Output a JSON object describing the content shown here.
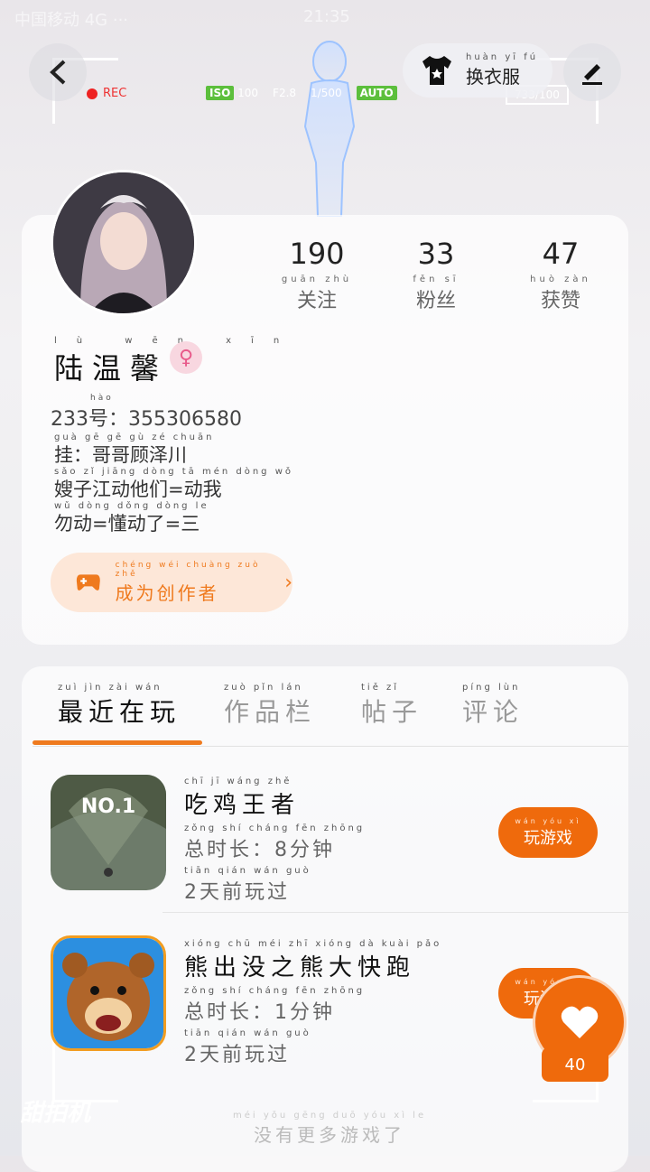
{
  "status": {
    "time": "21:35",
    "left": "中国移动 4G ···"
  },
  "camera": {
    "rec": "REC",
    "iso_tag": "ISO",
    "iso_val": "100",
    "aperture": "F2.8",
    "shutter": "1/500",
    "auto_tag": "AUTO",
    "counter": "733/100",
    "brand": "甜拍机"
  },
  "topbar": {
    "back_label": "返回",
    "outfit_pinyin": "huàn yī fú",
    "outfit_label": "换衣服"
  },
  "profile": {
    "stats": [
      {
        "num": "190",
        "pinyin": "guān zhù",
        "label": "关注"
      },
      {
        "num": "33",
        "pinyin": "fěn sī",
        "label": "粉丝"
      },
      {
        "num": "47",
        "pinyin": "huò zàn",
        "label": "获赞"
      }
    ],
    "name_pinyin": "lù wēn xīn",
    "name": "陆温馨",
    "gender_symbol": "♀",
    "id_pinyin": "hào",
    "id_line": "233号：355306580",
    "bio_lines": [
      {
        "pinyin": "guà   gē gē gù zé chuān",
        "text": "挂：哥哥顾泽川"
      },
      {
        "pinyin": "sǎo zǐ jiāng dòng tā mén dòng wǒ",
        "text": "嫂子江动他们=动我"
      },
      {
        "pinyin": "wǔ dòng  dǒng dòng le",
        "text": "勿动=懂动了=三"
      }
    ],
    "creator_pinyin": "chéng wéi chuàng zuò zhě",
    "creator_label": "成为创作者"
  },
  "tabs": [
    {
      "pinyin": "zuì jìn zài wán",
      "label": "最近在玩",
      "active": true
    },
    {
      "pinyin": "zuò pǐn lán",
      "label": "作品栏",
      "active": false
    },
    {
      "pinyin": "tiě zǐ",
      "label": "帖子",
      "active": false
    },
    {
      "pinyin": "píng lùn",
      "label": "评论",
      "active": false
    }
  ],
  "games": [
    {
      "title_pinyin": "chī jī wáng zhě",
      "title": "吃鸡王者",
      "time_pinyin": "zǒng shí cháng    fēn zhōng",
      "time": "总时长：8分钟",
      "ago_pinyin": "tiān qián wán guò",
      "ago": "2天前玩过",
      "icon_text": "NO.1",
      "play_pinyin": "wán yóu xì",
      "play": "玩游戏"
    },
    {
      "title_pinyin": "xióng chū méi zhī xióng dà kuài pǎo",
      "title": "熊出没之熊大快跑",
      "time_pinyin": "zǒng shí cháng    fēn zhōng",
      "time": "总时长：1分钟",
      "ago_pinyin": "tiān qián wán guò",
      "ago": "2天前玩过",
      "play_pinyin": "wán yóu xì",
      "play": "玩游戏"
    }
  ],
  "heart_count": "40",
  "footer": {
    "pinyin": "méi yǒu gēng duō yóu xì le",
    "text": "没有更多游戏了"
  },
  "colors": {
    "accent": "#ef6a0c",
    "creator_bg": "#fde7d8",
    "gender_bg": "#f8d7e0"
  }
}
